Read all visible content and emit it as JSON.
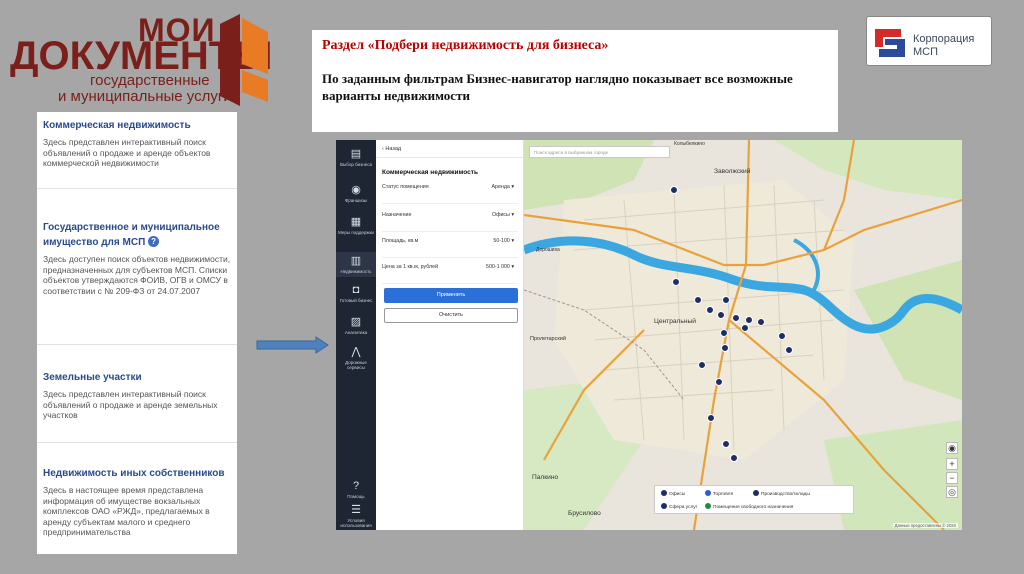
{
  "logo": {
    "word1": "МОИ",
    "word2": "ДОКУМЕНТЫ",
    "line3": "государственные",
    "line4": "и муниципальные услуги"
  },
  "left_panel": {
    "sections": [
      {
        "title": "Коммерческая недвижимость",
        "desc": "Здесь представлен интерактивный поиск объявлений о продаже и аренде объектов коммерческой недвижимости"
      },
      {
        "title": "Государственное и муниципальное имущество для МСП",
        "badge": "?",
        "desc": "Здесь доступен поиск объектов недвижимости, предназначенных для субъектов МСП. Списки объектов утверждаются ФОИВ, ОГВ и ОМСУ в соответствии с № 209-ФЗ от 24.07.2007"
      },
      {
        "title": "Земельные участки",
        "desc": "Здесь представлен интерактивный поиск объявлений о продаже и аренде земельных участков"
      },
      {
        "title": "Недвижимость иных собственников",
        "desc": "Здесь в настоящее время представлена информация об имуществе вокзальных комплексов ОАО «РЖД», предлагаемых в аренду субъектам малого и среднего предпринимательства"
      }
    ]
  },
  "heading": {
    "title": "Раздел «Подбери недвижимость для бизнеса»",
    "subtitle": "По заданным фильтрам Бизнес-навигатор наглядно показывает все возможные варианты недвижимости"
  },
  "msp_logo": {
    "line1": "Корпорация",
    "line2": "МСП"
  },
  "app": {
    "rail": [
      {
        "icon": "▤",
        "label": "Выбор бизнеса"
      },
      {
        "icon": "◉",
        "label": "Франшизы"
      },
      {
        "icon": "▦",
        "label": "Меры поддержки"
      },
      {
        "icon": "▥",
        "label": "Недвижимость"
      },
      {
        "icon": "◘",
        "label": "Готовый бизнес"
      },
      {
        "icon": "▨",
        "label": "Аналитика"
      },
      {
        "icon": "⋀",
        "label": "Дорожные сервисы"
      },
      {
        "icon": "?",
        "label": "Помощь"
      },
      {
        "icon": "☰",
        "label": "Условия использования"
      }
    ],
    "back_label": "‹ Назад",
    "panel_title": "Коммерческая недвижимость",
    "filters": [
      {
        "label": "Статус помещения",
        "value": "Аренда ▾"
      },
      {
        "label": "Назначение",
        "value": "Офисы ▾"
      },
      {
        "label": "Площадь, кв.м",
        "value": "50-100 ▾"
      },
      {
        "label": "Цена за 1 кв.м, рублей",
        "value": "500-1 000 ▾"
      }
    ],
    "apply_label": "Применить",
    "clear_label": "Очистить",
    "search_placeholder": "Поиск адреса в выбранном городе",
    "map_labels": [
      "Заволжский",
      "Центральный",
      "Пролетарский",
      "Палкино",
      "Брусилово",
      "Дорошиха",
      "Колыбелкино"
    ],
    "legend": [
      {
        "label": "Офисы",
        "color": "#1d2e66"
      },
      {
        "label": "Торговля",
        "color": "#2d5cc8"
      },
      {
        "label": "Производство/склады",
        "color": "#1d2e66"
      },
      {
        "label": "Сфера услуг",
        "color": "#1d2e66"
      },
      {
        "label": "Помещения свободного назначения",
        "color": "#1d8f3c"
      }
    ],
    "copyright": "Данные предоставлены © 2GIS"
  },
  "colors": {
    "brand_red": "#7a1f1a",
    "accent_blue": "#2b6fd8",
    "heading_red": "#b00000",
    "river": "#3aa7e0",
    "road": "#e9a23b"
  }
}
